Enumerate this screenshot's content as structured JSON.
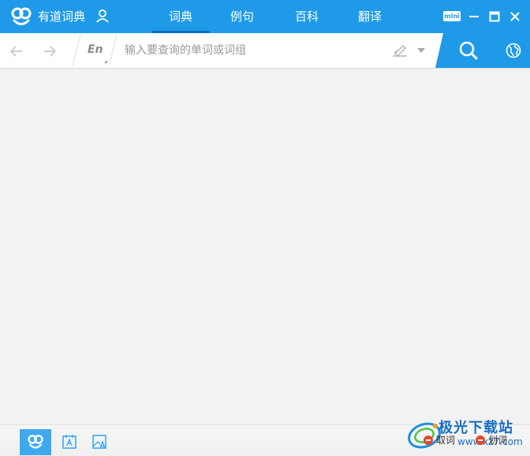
{
  "app": {
    "title": "有道词典"
  },
  "tabs": [
    {
      "label": "词典",
      "active": true
    },
    {
      "label": "例句",
      "active": false
    },
    {
      "label": "百科",
      "active": false
    },
    {
      "label": "翻译",
      "active": false
    }
  ],
  "window_controls": {
    "mini_label": "mini"
  },
  "search": {
    "language": "En",
    "placeholder": "输入要查询的单词或词组",
    "value": ""
  },
  "bottom": {
    "toggle_fetch": "取词",
    "toggle_select": "划词"
  },
  "watermark": {
    "text": "极光下载站",
    "url": "www.xz7.com"
  },
  "colors": {
    "accent": "#1f9ae8",
    "accent_dark": "#0b6fc1",
    "search_button": "#3fa9f0",
    "background": "#f2f2f2",
    "status_off": "#e14a2a"
  }
}
